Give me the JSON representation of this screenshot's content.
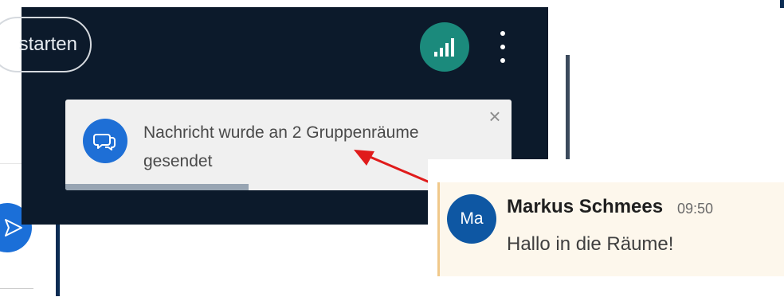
{
  "header": {
    "start_button_label": "starten",
    "signal_icon": "signal-bars-icon",
    "more_icon": "more-vertical-icon"
  },
  "toast": {
    "message": "Nachricht wurde an 2 Gruppenräume gesendet",
    "icon": "chat-bubbles-icon",
    "close_label": "×",
    "progress_fraction": 0.41
  },
  "chat": {
    "sender": "Markus Schmees",
    "time": "09:50",
    "avatar_initials": "Ma",
    "body": "Hallo in die Räume!"
  },
  "background": {
    "send_icon": "send-icon"
  },
  "colors": {
    "header_bg": "#0c1a2b",
    "signal_green": "#1b8a7c",
    "toast_icon_blue": "#1e6fd6",
    "avatar_blue": "#0e57a3",
    "annotation_red": "#e01b1b",
    "message_highlight": "#fdf7ec"
  }
}
